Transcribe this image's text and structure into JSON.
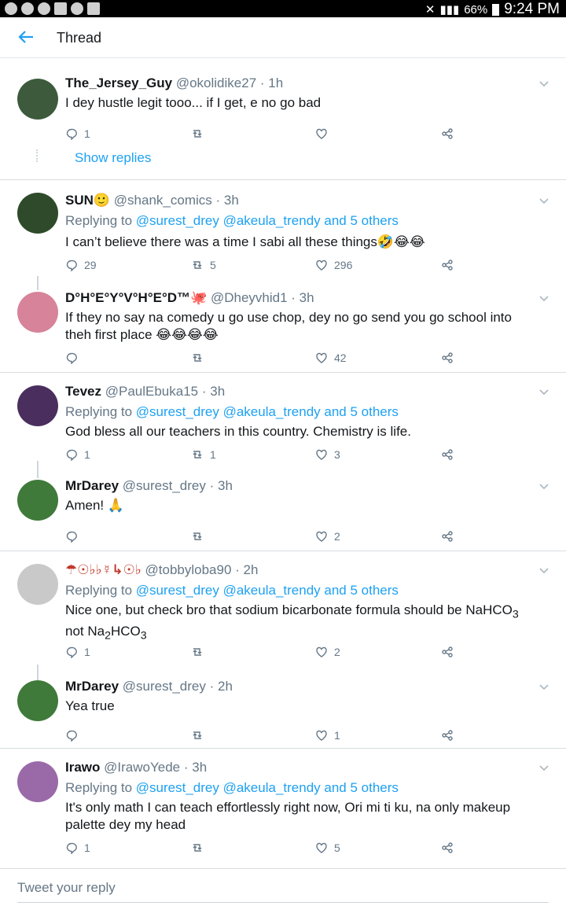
{
  "status_bar": {
    "battery": "66%",
    "time": "9:24 PM"
  },
  "header": {
    "title": "Thread"
  },
  "show_replies": "Show replies",
  "tweets": [
    {
      "name": "The_Jersey_Guy",
      "handle": "@okolidike27",
      "time": "1h",
      "replying": false,
      "text": "I dey hustle legit tooo... if I get, e no go bad",
      "replies": "1",
      "retweets": "",
      "likes": "",
      "avatar_color": "#3d5a3d"
    },
    {
      "name": "SUN🙂",
      "handle": "@shank_comics",
      "time": "3h",
      "replying": true,
      "text": "I can’t believe there was a time I sabi all these things🤣😂😂",
      "replies": "29",
      "retweets": "5",
      "likes": "296",
      "avatar_color": "#2e4a2a"
    },
    {
      "name": "D°H°E°Y°V°H°E°D™🐙",
      "handle": "@Dheyvhid1",
      "time": "3h",
      "replying": false,
      "text": "If they no say na comedy u go use chop, dey no go send you go school into theh first place 😂😂😂😂",
      "replies": "",
      "retweets": "",
      "likes": "42",
      "avatar_color": "#d7839a"
    },
    {
      "name": "Tevez",
      "handle": "@PaulEbuka15",
      "time": "3h",
      "replying": true,
      "text": "God bless all our teachers in this country. Chemistry is life.",
      "replies": "1",
      "retweets": "1",
      "likes": "3",
      "avatar_color": "#4a2f5e"
    },
    {
      "name": "MrDarey",
      "handle": "@surest_drey",
      "time": "3h",
      "replying": false,
      "text": "Amen! 🙏",
      "replies": "",
      "retweets": "",
      "likes": "2",
      "avatar_color": "#3f7a3a"
    },
    {
      "name": "☂☉♭♭☿↳☉♭",
      "handle": "@tobbyloba90",
      "time": "2h",
      "replying": true,
      "text_html_parts": [
        "Nice one, but check bro that sodium bicarbonate formula should be NaHCO",
        "3",
        " not Na",
        "2",
        "HCO",
        "3"
      ],
      "replies": "1",
      "retweets": "",
      "likes": "2",
      "avatar_color": "#c9c9c9"
    },
    {
      "name": "MrDarey",
      "handle": "@surest_drey",
      "time": "2h",
      "replying": false,
      "text": "Yea true",
      "replies": "",
      "retweets": "",
      "likes": "1",
      "avatar_color": "#3f7a3a"
    },
    {
      "name": "Irawo",
      "handle": "@IrawoYede",
      "time": "3h",
      "replying": true,
      "text": "It's only math I can teach effortlessly right now, Ori mi ti ku, na only makeup palette dey my head",
      "replies": "1",
      "retweets": "",
      "likes": "5",
      "avatar_color": "#9a6aa8"
    }
  ],
  "replying_to": {
    "prefix": "Replying to",
    "users": "@surest_drey @akeula_trendy and 5 others"
  },
  "compose": {
    "placeholder": "Tweet your reply"
  }
}
